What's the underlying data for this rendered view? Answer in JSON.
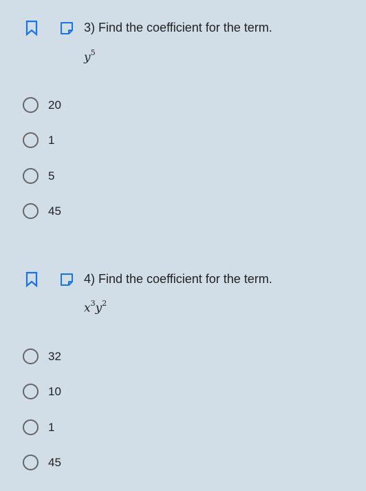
{
  "colors": {
    "background": "#d1dde7",
    "accent": "#1a73e8",
    "radio_border": "#666666",
    "text": "#222222"
  },
  "questions": [
    {
      "prompt": "3) Find the coefficient for the term.",
      "expr_parts": {
        "v1": "y",
        "e1": "5"
      },
      "options": [
        "20",
        "1",
        "5",
        "45"
      ],
      "icons": [
        "bookmark-icon",
        "note-icon",
        "radio-unselected-icon"
      ]
    },
    {
      "prompt": "4) Find the coefficient for the term.",
      "expr_parts": {
        "v1": "x",
        "e1": "3",
        "v2": "y",
        "e2": "2"
      },
      "options": [
        "32",
        "10",
        "1",
        "45"
      ],
      "icons": [
        "bookmark-icon",
        "note-icon",
        "radio-unselected-icon"
      ]
    }
  ]
}
